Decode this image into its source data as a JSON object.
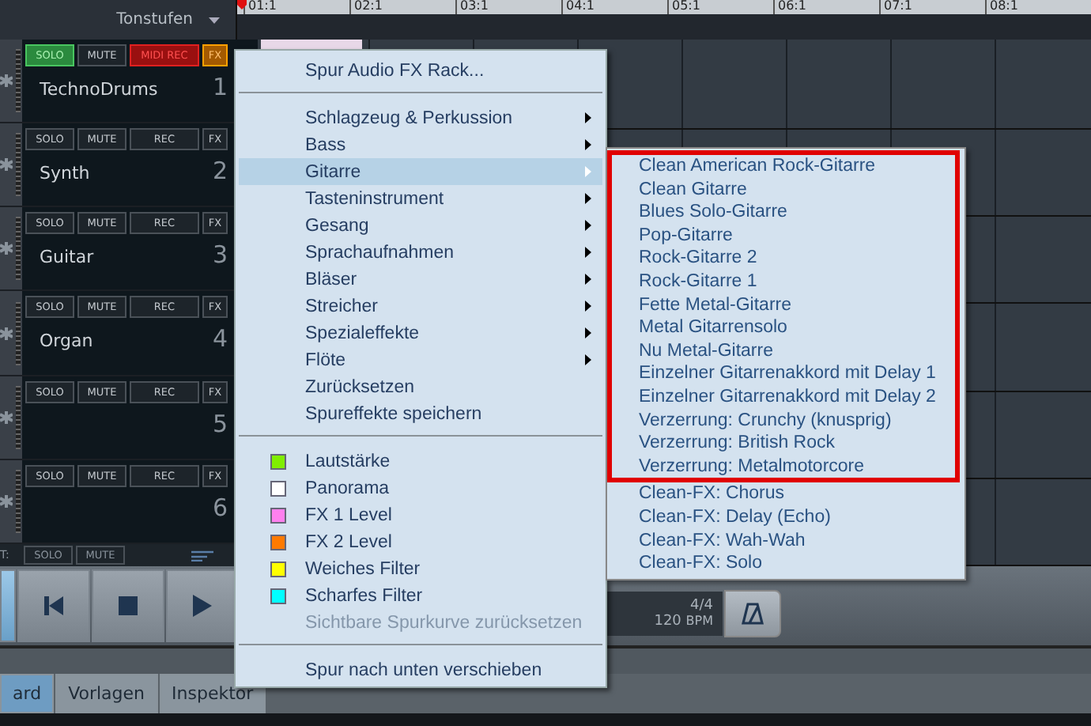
{
  "header": {
    "label": "Tonstufen"
  },
  "ruler": [
    "01:1",
    "02:1",
    "03:1",
    "04:1",
    "05:1",
    "06:1",
    "07:1",
    "08:1"
  ],
  "tracks": [
    {
      "name": "TechnoDrums",
      "number": "1",
      "clip": true,
      "buttons": [
        {
          "label": "SOLO",
          "kind": "solo",
          "on": true
        },
        {
          "label": "MUTE",
          "kind": "mute",
          "on": false
        },
        {
          "label": "MIDI REC",
          "kind": "rec",
          "on": true
        },
        {
          "label": "FX",
          "kind": "fx",
          "on": true
        }
      ]
    },
    {
      "name": "Synth",
      "number": "2",
      "clip": false,
      "buttons": [
        {
          "label": "SOLO",
          "kind": "solo",
          "on": false
        },
        {
          "label": "MUTE",
          "kind": "mute",
          "on": false
        },
        {
          "label": "REC",
          "kind": "rec",
          "on": false
        },
        {
          "label": "FX",
          "kind": "fx",
          "on": false
        }
      ]
    },
    {
      "name": "Guitar",
      "number": "3",
      "clip": false,
      "buttons": [
        {
          "label": "SOLO",
          "kind": "solo",
          "on": false
        },
        {
          "label": "MUTE",
          "kind": "mute",
          "on": false
        },
        {
          "label": "REC",
          "kind": "rec",
          "on": false
        },
        {
          "label": "FX",
          "kind": "fx",
          "on": false
        }
      ]
    },
    {
      "name": "Organ",
      "number": "4",
      "clip": false,
      "buttons": [
        {
          "label": "SOLO",
          "kind": "solo",
          "on": false
        },
        {
          "label": "MUTE",
          "kind": "mute",
          "on": false
        },
        {
          "label": "REC",
          "kind": "rec",
          "on": false
        },
        {
          "label": "FX",
          "kind": "fx",
          "on": false
        }
      ]
    },
    {
      "number": "5",
      "clip": false,
      "buttons": [
        {
          "label": "SOLO",
          "kind": "solo",
          "on": false
        },
        {
          "label": "MUTE",
          "kind": "mute",
          "on": false
        },
        {
          "label": "REC",
          "kind": "rec",
          "on": false
        },
        {
          "label": "FX",
          "kind": "fx",
          "on": false
        }
      ]
    },
    {
      "number": "6",
      "clip": false,
      "buttons": [
        {
          "label": "SOLO",
          "kind": "solo",
          "on": false
        },
        {
          "label": "MUTE",
          "kind": "mute",
          "on": false
        },
        {
          "label": "REC",
          "kind": "rec",
          "on": false
        },
        {
          "label": "FX",
          "kind": "fx",
          "on": false
        }
      ]
    }
  ],
  "master": {
    "label": "T:",
    "buttons": [
      "SOLO",
      "MUTE"
    ]
  },
  "transport": {
    "buttons": [
      {
        "kind": "blank",
        "selected": true
      },
      {
        "kind": "skip-back",
        "selected": false
      },
      {
        "kind": "stop",
        "selected": false
      },
      {
        "kind": "play",
        "selected": false
      }
    ],
    "time_signature": "4/4",
    "tempo": "120",
    "tempo_unit": "BPM"
  },
  "tabs": [
    {
      "label": "ard",
      "selected": true
    },
    {
      "label": "Vorlagen",
      "selected": false
    },
    {
      "label": "Inspektor",
      "selected": false
    }
  ],
  "context_menu": {
    "items": [
      {
        "kind": "action",
        "label": "Spur Audio FX Rack...",
        "selected": false,
        "disabled": false
      },
      {
        "kind": "separator"
      },
      {
        "kind": "submenu",
        "label": "Schlagzeug & Perkussion",
        "selected": false,
        "disabled": false
      },
      {
        "kind": "submenu",
        "label": "Bass",
        "selected": false,
        "disabled": false
      },
      {
        "kind": "submenu",
        "label": "Gitarre",
        "selected": true,
        "disabled": false
      },
      {
        "kind": "submenu",
        "label": "Tasteninstrument",
        "selected": false,
        "disabled": false
      },
      {
        "kind": "submenu",
        "label": "Gesang",
        "selected": false,
        "disabled": false
      },
      {
        "kind": "submenu",
        "label": "Sprachaufnahmen",
        "selected": false,
        "disabled": false
      },
      {
        "kind": "submenu",
        "label": "Bläser",
        "selected": false,
        "disabled": false
      },
      {
        "kind": "submenu",
        "label": "Streicher",
        "selected": false,
        "disabled": false
      },
      {
        "kind": "submenu",
        "label": "Spezialeffekte",
        "selected": false,
        "disabled": false
      },
      {
        "kind": "submenu",
        "label": "Flöte",
        "selected": false,
        "disabled": false
      },
      {
        "kind": "action",
        "label": "Zurücksetzen",
        "selected": false,
        "disabled": false
      },
      {
        "kind": "action",
        "label": "Spureffekte speichern",
        "selected": false,
        "disabled": false
      },
      {
        "kind": "separator"
      },
      {
        "kind": "curve",
        "label": "Lautstärke",
        "color": "#80ee00",
        "selected": false,
        "disabled": false
      },
      {
        "kind": "curve",
        "label": "Panorama",
        "color": "#ffffff",
        "selected": false,
        "disabled": false
      },
      {
        "kind": "curve",
        "label": "FX 1 Level",
        "color": "#ff80ee",
        "selected": false,
        "disabled": false
      },
      {
        "kind": "curve",
        "label": "FX 2 Level",
        "color": "#ff7a00",
        "selected": false,
        "disabled": false
      },
      {
        "kind": "curve",
        "label": "Weiches Filter",
        "color": "#ffff00",
        "selected": false,
        "disabled": false
      },
      {
        "kind": "curve",
        "label": "Scharfes Filter",
        "color": "#00ffff",
        "selected": false,
        "disabled": false
      },
      {
        "kind": "action",
        "label": "Sichtbare Spurkurve zurücksetzen",
        "selected": false,
        "disabled": true
      },
      {
        "kind": "separator"
      },
      {
        "kind": "action",
        "label": "Spur nach unten verschieben",
        "selected": false,
        "disabled": false
      }
    ]
  },
  "submenu": {
    "items": [
      {
        "label": "Clean American Rock-Gitarre",
        "framed": true
      },
      {
        "label": "Clean Gitarre",
        "framed": true
      },
      {
        "label": "Blues Solo-Gitarre",
        "framed": true
      },
      {
        "label": "Pop-Gitarre",
        "framed": true
      },
      {
        "label": "Rock-Gitarre 2",
        "framed": true
      },
      {
        "label": "Rock-Gitarre 1",
        "framed": true
      },
      {
        "label": "Fette Metal-Gitarre",
        "framed": true
      },
      {
        "label": "Metal Gitarrensolo",
        "framed": true
      },
      {
        "label": "Nu Metal-Gitarre",
        "framed": true
      },
      {
        "label": "Einzelner Gitarrenakkord mit Delay 1",
        "framed": true
      },
      {
        "label": "Einzelner Gitarrenakkord mit Delay 2",
        "framed": true
      },
      {
        "label": "Verzerrung: Crunchy (knusprig)",
        "framed": true
      },
      {
        "label": "Verzerrung: British Rock",
        "framed": true
      },
      {
        "label": "Verzerrung: Metalmotorcore",
        "framed": true
      },
      {
        "label": "Clean-FX: Chorus",
        "framed": false
      },
      {
        "label": "Clean-FX: Delay (Echo)",
        "framed": false
      },
      {
        "label": "Clean-FX: Wah-Wah",
        "framed": false
      },
      {
        "label": "Clean-FX: Solo",
        "framed": false
      }
    ]
  }
}
